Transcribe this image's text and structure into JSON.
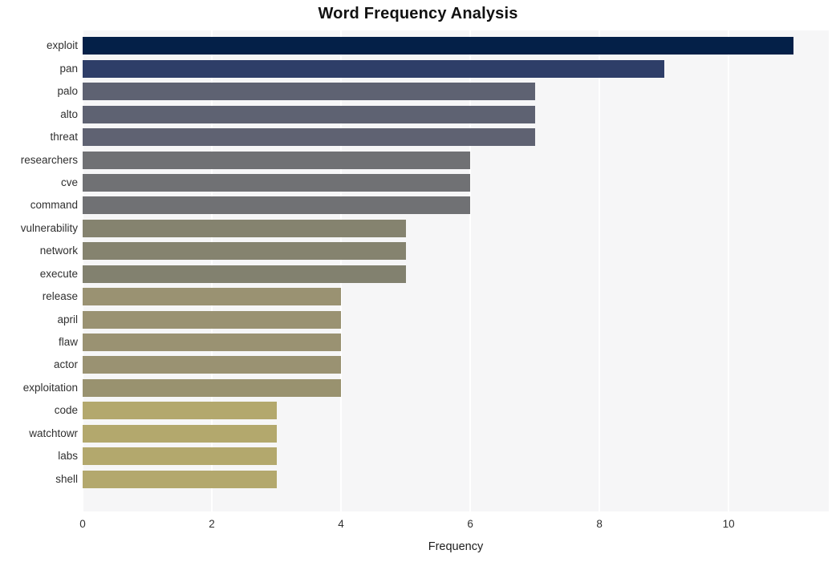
{
  "chart_data": {
    "type": "bar",
    "orientation": "horizontal",
    "title": "Word Frequency Analysis",
    "xlabel": "Frequency",
    "ylabel": "",
    "categories": [
      "exploit",
      "pan",
      "palo",
      "alto",
      "threat",
      "researchers",
      "cve",
      "command",
      "vulnerability",
      "network",
      "execute",
      "release",
      "april",
      "flaw",
      "actor",
      "exploitation",
      "code",
      "watchtowr",
      "labs",
      "shell"
    ],
    "values": [
      11,
      9,
      7,
      7,
      7,
      6,
      6,
      6,
      5,
      5,
      5,
      4,
      4,
      4,
      4,
      4,
      3,
      3,
      3,
      3
    ],
    "bar_colors": [
      "#042048",
      "#2e3e68",
      "#5e6272",
      "#5e6272",
      "#5f6272",
      "#707174",
      "#707174",
      "#707174",
      "#85836f",
      "#85836f",
      "#82816f",
      "#9a9272",
      "#9a9272",
      "#9a9272",
      "#9a9272",
      "#99926f",
      "#b3a86d",
      "#b3a86d",
      "#b3a86d",
      "#b3a86d"
    ],
    "xticks": [
      0,
      2,
      4,
      6,
      8,
      10
    ],
    "xlim": [
      0,
      11.55
    ],
    "grid": "vertical-only",
    "legend": "none",
    "plot_background": "#f6f6f7",
    "gridline_color": "#ffffff",
    "series": [
      {
        "name": "Frequency",
        "points": [
          {
            "label": "exploit",
            "value": 11
          },
          {
            "label": "pan",
            "value": 9
          },
          {
            "label": "palo",
            "value": 7
          },
          {
            "label": "alto",
            "value": 7
          },
          {
            "label": "threat",
            "value": 7
          },
          {
            "label": "researchers",
            "value": 6
          },
          {
            "label": "cve",
            "value": 6
          },
          {
            "label": "command",
            "value": 6
          },
          {
            "label": "vulnerability",
            "value": 5
          },
          {
            "label": "network",
            "value": 5
          },
          {
            "label": "execute",
            "value": 5
          },
          {
            "label": "release",
            "value": 4
          },
          {
            "label": "april",
            "value": 4
          },
          {
            "label": "flaw",
            "value": 4
          },
          {
            "label": "actor",
            "value": 4
          },
          {
            "label": "exploitation",
            "value": 4
          },
          {
            "label": "code",
            "value": 3
          },
          {
            "label": "watchtowr",
            "value": 3
          },
          {
            "label": "labs",
            "value": 3
          },
          {
            "label": "shell",
            "value": 3
          }
        ]
      }
    ]
  }
}
